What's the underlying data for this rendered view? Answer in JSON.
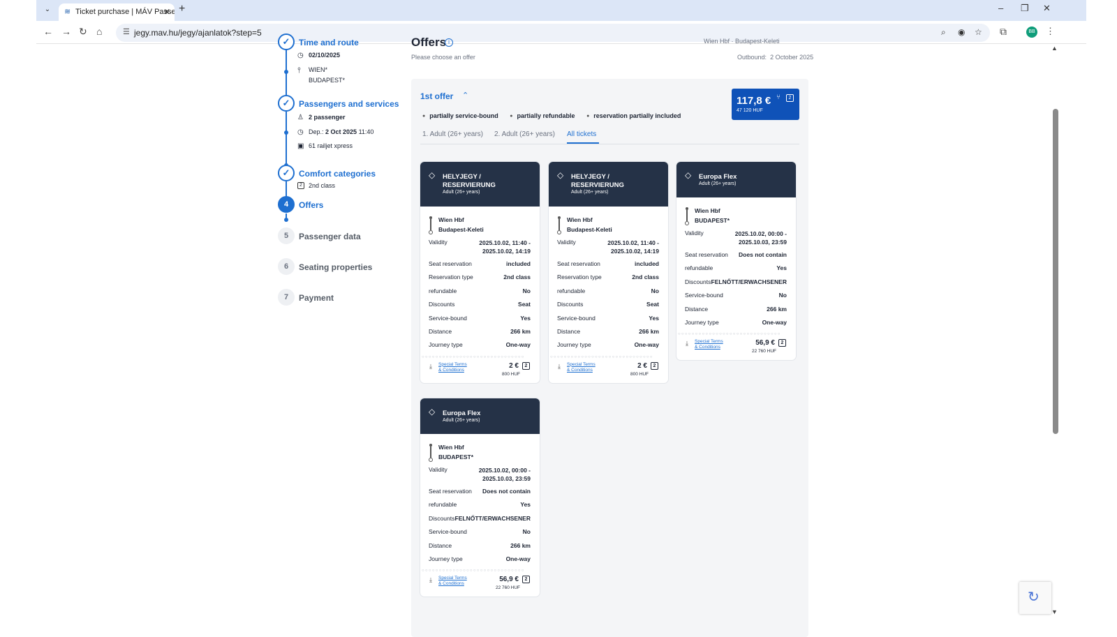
{
  "browser": {
    "tab_title": "Ticket purchase | MÁV Passen",
    "url": "jegy.mav.hu/jegy/ajanlatok?step=5",
    "avatar_initials": "BB"
  },
  "stepper": {
    "steps": [
      {
        "num": "1",
        "title": "Time and route",
        "state": "done"
      },
      {
        "num": "2",
        "title": "Passengers and services",
        "state": "done"
      },
      {
        "num": "3",
        "title": "Comfort categories",
        "state": "done"
      },
      {
        "num": "4",
        "title": "Offers",
        "state": "active"
      },
      {
        "num": "5",
        "title": "Passenger data",
        "state": "inactive"
      },
      {
        "num": "6",
        "title": "Seating properties",
        "state": "inactive"
      },
      {
        "num": "7",
        "title": "Payment",
        "state": "inactive"
      }
    ],
    "route_date": "02/10/2025",
    "route_from": "WIEN*",
    "route_to": "BUDAPEST*",
    "passengers": "2 passenger",
    "dep_label": "Dep.:",
    "dep_date": "2 Oct 2025",
    "dep_time": "11:40",
    "train": "61 railjet xpress",
    "comfort_class": "2nd class"
  },
  "offers": {
    "heading": "Offers",
    "subtitle": "Please choose an offer",
    "route_top": "Wien Hbf  ·  Budapest-Keleti",
    "outbound_label": "Outbound:",
    "outbound_date": "2 October 2025",
    "offer_title": "1st offer",
    "tags": [
      "partially service-bound",
      "partially refundable",
      "reservation partially included"
    ],
    "total_price": "117,8 €",
    "total_huf": "47 120  HUF",
    "class_badge": "2",
    "tabs": [
      "1. Adult (26+ years)",
      "2. Adult (26+ years)",
      "All tickets"
    ],
    "active_tab": 2
  },
  "tickets": [
    {
      "title": "HELYJEGY / RESERVIERUNG",
      "subtitle": "Adult (26+ years)",
      "from": "Wien Hbf",
      "to": "Budapest-Keleti",
      "validity_label": "Validity",
      "validity": "2025.10.02, 11:40 -",
      "validity2": "2025.10.02, 14:19",
      "rows": [
        {
          "k": "Seat reservation",
          "v": "included"
        },
        {
          "k": "Reservation type",
          "v": "2nd class"
        },
        {
          "k": "refundable",
          "v": "No"
        },
        {
          "k": "Discounts",
          "v": "Seat"
        },
        {
          "k": "Service-bound",
          "v": "Yes"
        },
        {
          "k": "Distance",
          "v": "266 km"
        },
        {
          "k": "Journey type",
          "v": "One-way"
        }
      ],
      "terms1": "Special Terms",
      "terms2": "& Conditions",
      "price": "2 €",
      "huf": "800  HUF",
      "cls": "2"
    },
    {
      "title": "HELYJEGY / RESERVIERUNG",
      "subtitle": "Adult (26+ years)",
      "from": "Wien Hbf",
      "to": "Budapest-Keleti",
      "validity_label": "Validity",
      "validity": "2025.10.02, 11:40 -",
      "validity2": "2025.10.02, 14:19",
      "rows": [
        {
          "k": "Seat reservation",
          "v": "included"
        },
        {
          "k": "Reservation type",
          "v": "2nd class"
        },
        {
          "k": "refundable",
          "v": "No"
        },
        {
          "k": "Discounts",
          "v": "Seat"
        },
        {
          "k": "Service-bound",
          "v": "Yes"
        },
        {
          "k": "Distance",
          "v": "266 km"
        },
        {
          "k": "Journey type",
          "v": "One-way"
        }
      ],
      "terms1": "Special Terms",
      "terms2": "& Conditions",
      "price": "2 €",
      "huf": "800  HUF",
      "cls": "2"
    },
    {
      "title": "Europa Flex",
      "subtitle": "Adult (26+ years)",
      "from": "Wien Hbf",
      "to": "BUDAPEST*",
      "validity_label": "Validity",
      "validity": "2025.10.02, 00:00 -",
      "validity2": "2025.10.03, 23:59",
      "rows": [
        {
          "k": "Seat reservation",
          "v": "Does not contain"
        },
        {
          "k": "refundable",
          "v": "Yes"
        },
        {
          "k": "Discounts",
          "v": "FELNŐTT/ERWACHSENER"
        },
        {
          "k": "Service-bound",
          "v": "No"
        },
        {
          "k": "Distance",
          "v": "266 km"
        },
        {
          "k": "Journey type",
          "v": "One-way"
        }
      ],
      "terms1": "Special Terms",
      "terms2": "& Conditions",
      "price": "56,9 €",
      "huf": "22 760  HUF",
      "cls": "2"
    },
    {
      "title": "Europa Flex",
      "subtitle": "Adult (26+ years)",
      "from": "Wien Hbf",
      "to": "BUDAPEST*",
      "validity_label": "Validity",
      "validity": "2025.10.02, 00:00 -",
      "validity2": "2025.10.03, 23:59",
      "rows": [
        {
          "k": "Seat reservation",
          "v": "Does not contain"
        },
        {
          "k": "refundable",
          "v": "Yes"
        },
        {
          "k": "Discounts",
          "v": "FELNŐTT/ERWACHSENER"
        },
        {
          "k": "Service-bound",
          "v": "No"
        },
        {
          "k": "Distance",
          "v": "266 km"
        },
        {
          "k": "Journey type",
          "v": "One-way"
        }
      ],
      "terms1": "Special Terms",
      "terms2": "& Conditions",
      "price": "56,9 €",
      "huf": "22 760  HUF",
      "cls": "2"
    }
  ]
}
